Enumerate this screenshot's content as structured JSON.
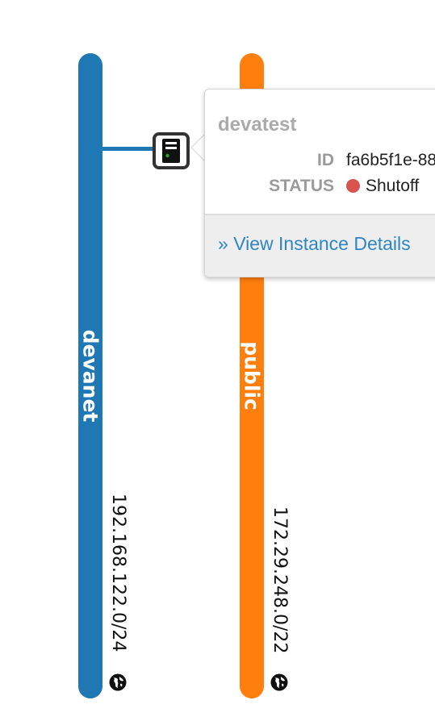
{
  "networks": [
    {
      "name": "devanet",
      "cidr": "192.168.122.0/24",
      "color": "#1f77b4",
      "icon": "globe-icon"
    },
    {
      "name": "public",
      "cidr": "172.29.248.0/22",
      "color": "#ff7f0e",
      "icon": "globe-icon"
    }
  ],
  "instance": {
    "icon": "server-icon",
    "status_color": "#2ca02c"
  },
  "popover": {
    "title": "devatest",
    "id_label": "ID",
    "id_value": "fa6b5f1e-88",
    "status_label": "STATUS",
    "status_value": "Shutoff",
    "status_dot_color": "#d9534f",
    "link_prefix": "»",
    "link_text": "View Instance Details"
  },
  "colors": {
    "link_line": "#1f77b4"
  }
}
